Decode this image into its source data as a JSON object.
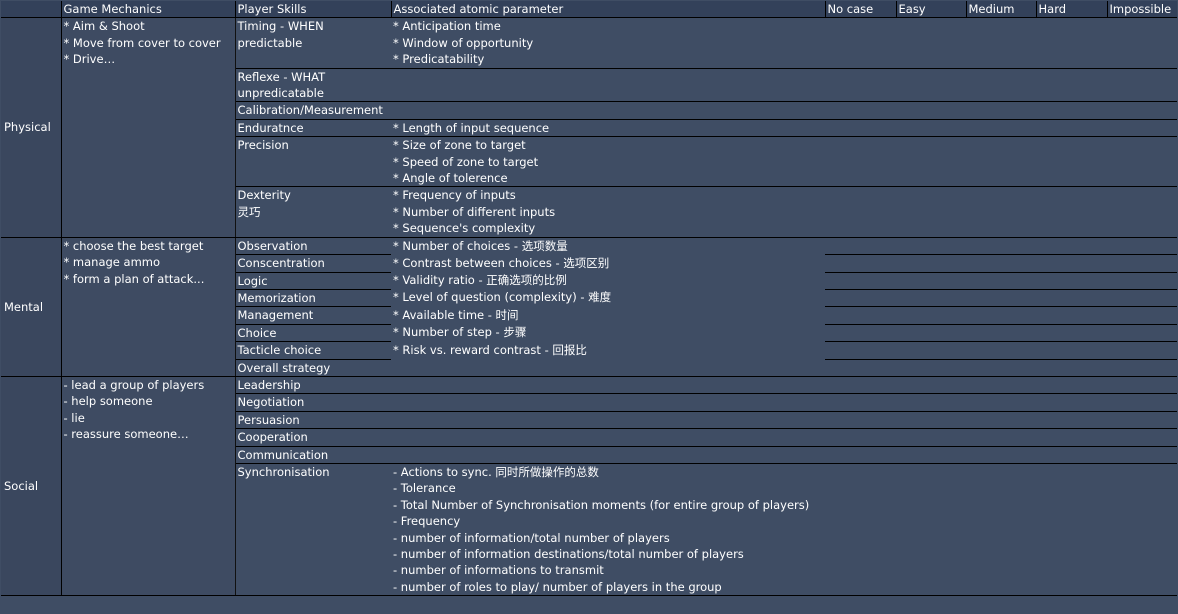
{
  "headers": [
    "Game Mechanics",
    "Player Skills",
    "Associated atomic parameter",
    "No case",
    "Easy",
    "Medium",
    "Hard",
    "Impossible"
  ],
  "categories": {
    "physical": "Physical",
    "mental": "Mental",
    "social": "Social"
  },
  "physical": {
    "mechanics": [
      "* Aim & Shoot",
      "* Move from cover to cover",
      "* Drive…"
    ],
    "timing_1": "Timing - WHEN",
    "timing_2": "predictable",
    "timing_params": [
      "* Anticipation time",
      "* Window of opportunity",
      "* Predicatability"
    ],
    "reflexe_1": "Reflexe - WHAT",
    "reflexe_2": "unpredicatable",
    "calibration": "Calibration/Measurement",
    "endurance": "Enduratnce",
    "endurance_param": "* Length of input sequence",
    "precision": "Precision",
    "precision_params": [
      "* Size of zone to target",
      "* Speed of zone to target",
      "* Angle of tolerence"
    ],
    "dexterity_1": "Dexterity",
    "dexterity_2": "灵巧",
    "dexterity_params": [
      "* Frequency of inputs",
      "* Number of different inputs",
      "* Sequence's complexity"
    ]
  },
  "mental": {
    "mechanics": [
      "* choose the best target",
      "* manage ammo",
      "* form a plan of attack..."
    ],
    "skills": [
      "Observation",
      "Conscentration",
      "Logic",
      "Memorization",
      "Management",
      "Choice",
      "Tacticle choice",
      "Overall strategy"
    ],
    "params": [
      "* Number of choices - 选项数量",
      "* Contrast between choices - 选项区别",
      "* Validity ratio - 正确选项的比例",
      "* Level of question (complexity) - 难度",
      "* Available time - 时间",
      "* Number of step - 步骤",
      "* Risk vs. reward contrast - 回报比"
    ]
  },
  "social": {
    "mechanics": [
      "- lead a group of players",
      "- help someone",
      "- lie",
      "- reassure someone…"
    ],
    "skills": [
      "Leadership",
      "Negotiation",
      "Persuasion",
      "Cooperation",
      "Communication",
      "Synchronisation"
    ],
    "sync_params": [
      "- Actions to sync. 同时所做操作的总数",
      "- Tolerance",
      "- Total Number of Synchronisation moments (for entire group of players)",
      "- Frequency",
      "- number of information/total number of players",
      "- number of information destinations/total number of players",
      "- number of informations to transmit",
      "- number of roles to play/ number of players in the group"
    ]
  }
}
